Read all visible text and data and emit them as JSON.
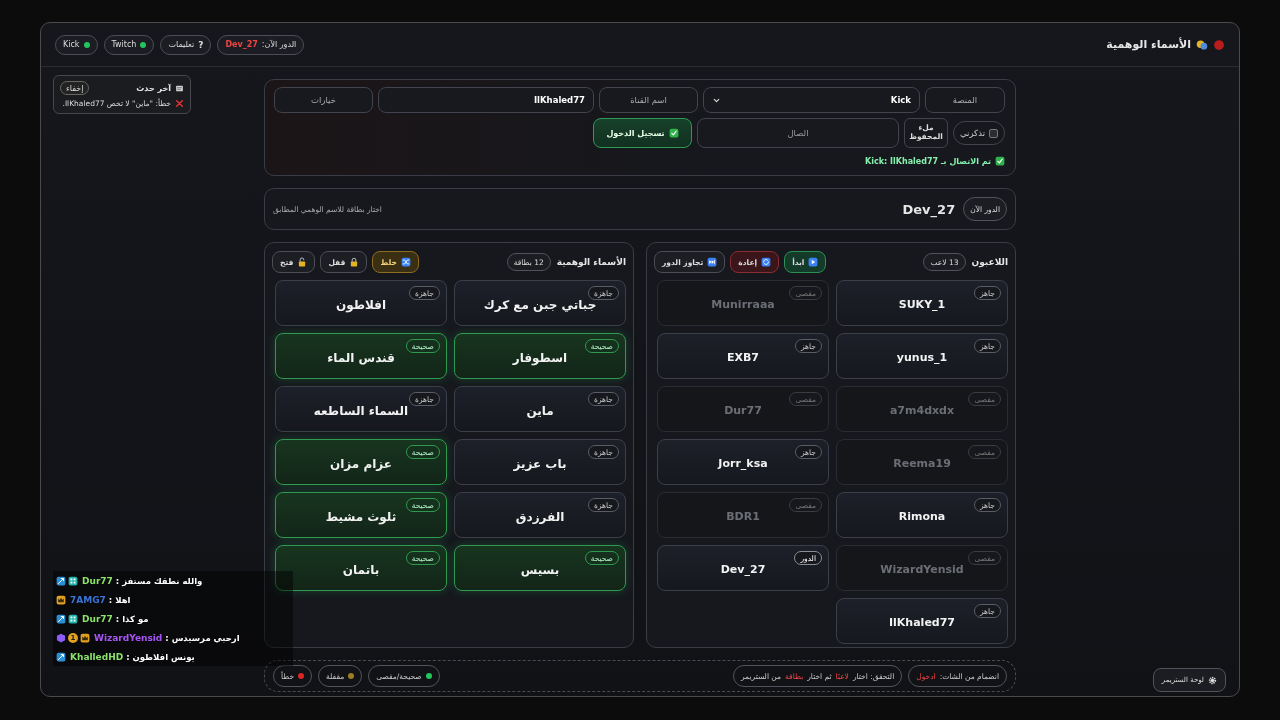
{
  "window": {
    "title": "الأسماء الوهمية"
  },
  "top_bar": {
    "turn_label": "الدور الآن:",
    "turn_player": "Dev_27",
    "help": {
      "icon": "?",
      "label": "تعليمات"
    },
    "platforms": [
      {
        "label": "Twitch",
        "connected": true
      },
      {
        "label": "Kick",
        "connected": true
      }
    ]
  },
  "last_event": {
    "title": "آخر حدث",
    "hide": "إخفاء",
    "message": "خطأ: \"ماين\" لا تخص IlKhaled77."
  },
  "connection": {
    "platform_label": "المنصة",
    "platform": "Kick",
    "channel_label": "اسم القناة",
    "channel": "IlKhaled77",
    "options": "خيارات",
    "remember": {
      "label": "تذكرني",
      "checked": false
    },
    "fill_saved": "ملء المحفوظ",
    "token_placeholder": "الصال",
    "login": "تسجيل الدخول",
    "status": "تم الاتصال بـ Kick: IlKhaled77"
  },
  "turn": {
    "label": "الدور الآن",
    "player": "Dev_27",
    "hint": "اختار بطاقة للاسم الوهمي المطابق"
  },
  "players": {
    "title": "اللاعبون",
    "count": "13 لاعب",
    "actions": [
      {
        "kind": "start",
        "label": "ابدأ"
      },
      {
        "kind": "reset",
        "label": "إعادة"
      },
      {
        "kind": "skip",
        "label": "تجاوز الدور"
      }
    ],
    "items": [
      {
        "name": "SUKY_1",
        "status": "جاهز",
        "kind": "ready"
      },
      {
        "name": "Munirraaa",
        "status": "مقصى",
        "kind": "out"
      },
      {
        "name": "yunus_1",
        "status": "جاهز",
        "kind": "ready"
      },
      {
        "name": "EXB7",
        "status": "جاهز",
        "kind": "ready"
      },
      {
        "name": "a7m4dxdx",
        "status": "مقصى",
        "kind": "out"
      },
      {
        "name": "Dur77",
        "status": "مقصى",
        "kind": "out"
      },
      {
        "name": "Reema19",
        "status": "مقصى",
        "kind": "out"
      },
      {
        "name": "Jorr_ksa",
        "status": "جاهز",
        "kind": "ready"
      },
      {
        "name": "Rimona",
        "status": "جاهز",
        "kind": "ready"
      },
      {
        "name": "BDR1",
        "status": "مقصى",
        "kind": "out"
      },
      {
        "name": "WizardYensid",
        "status": "مقصى",
        "kind": "out"
      },
      {
        "name": "Dev_27",
        "status": "الدور",
        "kind": "turn"
      },
      {
        "name": "IlKhaled77",
        "status": "جاهز",
        "kind": "ready"
      }
    ]
  },
  "names": {
    "title": "الأسماء الوهمية",
    "count": "12 بطاقة",
    "actions": [
      {
        "kind": "shuffle",
        "label": "خلط"
      },
      {
        "kind": "lock",
        "label": "قفل"
      },
      {
        "kind": "unlock",
        "label": "فتح"
      }
    ],
    "items": [
      {
        "name": "جباتي جبن مع كرك",
        "status": "جاهزة",
        "kind": "ready"
      },
      {
        "name": "افلاطون",
        "status": "جاهزة",
        "kind": "ready"
      },
      {
        "name": "اسطوفار",
        "status": "صحيحة",
        "kind": "correct"
      },
      {
        "name": "قندس الماء",
        "status": "صحيحة",
        "kind": "correct"
      },
      {
        "name": "ماين",
        "status": "جاهزة",
        "kind": "ready"
      },
      {
        "name": "السماء الساطعه",
        "status": "جاهزة",
        "kind": "ready"
      },
      {
        "name": "باب عزيز",
        "status": "جاهزة",
        "kind": "ready"
      },
      {
        "name": "عزام مزان",
        "status": "صحيحة",
        "kind": "correct"
      },
      {
        "name": "الفرزدق",
        "status": "جاهزة",
        "kind": "ready"
      },
      {
        "name": "ثلوث مشيط",
        "status": "صحيحة",
        "kind": "correct"
      },
      {
        "name": "بسيس",
        "status": "صحيحة",
        "kind": "correct"
      },
      {
        "name": "باتمان",
        "status": "صحيحة",
        "kind": "correct"
      }
    ]
  },
  "footer": {
    "hints": [
      {
        "parts": [
          {
            "text": "انضمام من الشات: ",
            "highlight": false
          },
          {
            "text": "ادخول",
            "highlight": true
          }
        ]
      },
      {
        "parts": [
          {
            "text": "التحقق: اختار ",
            "highlight": false
          },
          {
            "text": "لاعبًا",
            "highlight": true
          },
          {
            "text": " ثم اختار ",
            "highlight": false
          },
          {
            "text": "بطاقة",
            "highlight": true
          },
          {
            "text": " من الستريمر",
            "highlight": false
          }
        ]
      }
    ],
    "legend": [
      {
        "label": "صحيحة/مقصى",
        "color": "#22c55e"
      },
      {
        "label": "مقفلة",
        "color": "#9a7f22"
      },
      {
        "label": "خطأ",
        "color": "#dc2626"
      }
    ]
  },
  "chat": [
    {
      "user": "Dur77",
      "color": "#8be36a",
      "text": ": والله نطقك مستفز",
      "badges": [
        {
          "kind": "mod"
        },
        {
          "kind": "sub"
        }
      ]
    },
    {
      "user": "7AMG7",
      "color": "#3b74d6",
      "text": ": اهلا",
      "badges": [
        {
          "kind": "crown"
        }
      ]
    },
    {
      "user": "Dur77",
      "color": "#8be36a",
      "text": ": مو كذا",
      "badges": [
        {
          "kind": "mod"
        },
        {
          "kind": "sub"
        }
      ]
    },
    {
      "user": "WizardYensid",
      "color": "#a855f7",
      "text": ": ارحبي مرسيدس",
      "badges": [
        {
          "kind": "gem"
        },
        {
          "kind": "count",
          "label": "1"
        },
        {
          "kind": "crown"
        }
      ]
    },
    {
      "user": "KhalledHD",
      "color": "#8be36a",
      "text": ": يونس افلاطون",
      "badges": [
        {
          "kind": "mod"
        }
      ]
    }
  ],
  "streamer_panel": "لوحة الستريمر"
}
